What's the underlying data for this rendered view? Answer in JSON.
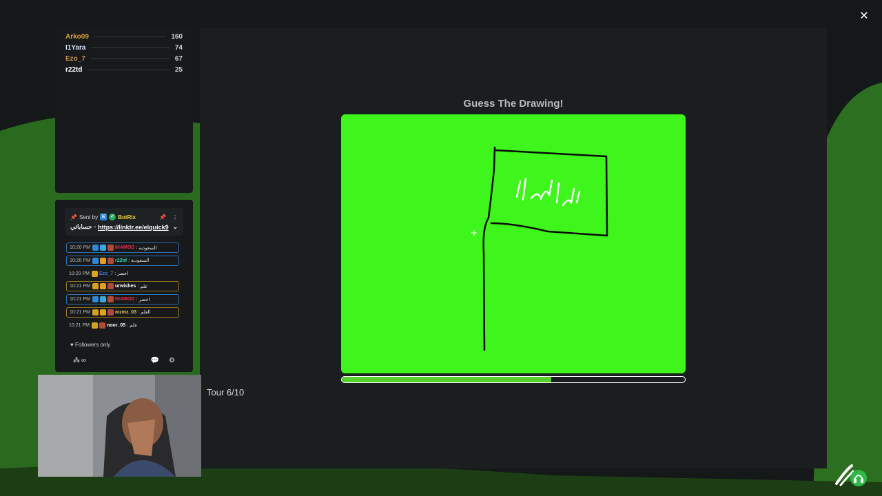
{
  "window": {
    "close_icon": "✕"
  },
  "leaderboard": [
    {
      "name": "Arko09",
      "score": "160",
      "color": "#d6a23a"
    },
    {
      "name": "I1Yara",
      "score": "74",
      "color": "#cfe0ff"
    },
    {
      "name": "Ezo_7",
      "score": "67",
      "color": "#c8925a"
    },
    {
      "name": "r22td",
      "score": "25",
      "color": "#ffffff"
    }
  ],
  "chat": {
    "pinned": {
      "sent_by": "Sent by",
      "bot_name": "BotRix",
      "link_prefix": "حساباتي -",
      "link_text": "https://linktr.ee/elquick9"
    },
    "messages": [
      {
        "time": "10:20 PM",
        "user": "IHAMOD",
        "text": "السعوديه",
        "user_color": "#e0304a",
        "border": "blue",
        "badges": [
          "#2f88d8",
          "#3aa7d6",
          "#b04b3a"
        ]
      },
      {
        "time": "10:20 PM",
        "user": "r22td",
        "text": "السعودية",
        "user_color": "#3ad0b0",
        "border": "blue",
        "badges": [
          "#2f88d8",
          "#e0a020",
          "#b04b3a"
        ]
      },
      {
        "time": "10:20 PM",
        "user": "Ezo_7",
        "text": "اخضر",
        "user_color": "#3a7ad8",
        "border": "none",
        "badges": [
          "#e0a020"
        ]
      },
      {
        "time": "10:21 PM",
        "user": "urwishes",
        "text": "علم",
        "user_color": "#ffffff",
        "border": "yellow",
        "badges": [
          "#d4a020",
          "#e0a020",
          "#b04b3a"
        ]
      },
      {
        "time": "10:21 PM",
        "user": "IHAMOD",
        "text": "اخضر",
        "user_color": "#e0304a",
        "border": "blue",
        "badges": [
          "#2f88d8",
          "#3aa7d6",
          "#b04b3a"
        ]
      },
      {
        "time": "10:21 PM",
        "user": "mzmz_03",
        "text": "العلم",
        "user_color": "#e8c86a",
        "border": "yellow",
        "badges": [
          "#d4a020",
          "#e0a020",
          "#b04b3a"
        ]
      },
      {
        "time": "10:21 PM",
        "user": "noor_05",
        "text": "علم",
        "user_color": "#ffffff",
        "border": "none",
        "badges": [
          "#d4a020",
          "#b04b3a"
        ]
      }
    ],
    "followers_only": "Followers only",
    "viewer_count": "∞"
  },
  "game": {
    "title": "Guess The Drawing!",
    "round_label": "Tour 6/10",
    "progress": 0.61,
    "canvas_color": "#3ef51c"
  },
  "icons": {
    "pin": "pin-icon",
    "more": "more-vertical-icon",
    "chevron": "chevron-down-icon",
    "heart": "heart-icon",
    "settings": "gear-icon",
    "chat": "chat-bubble-icon"
  }
}
